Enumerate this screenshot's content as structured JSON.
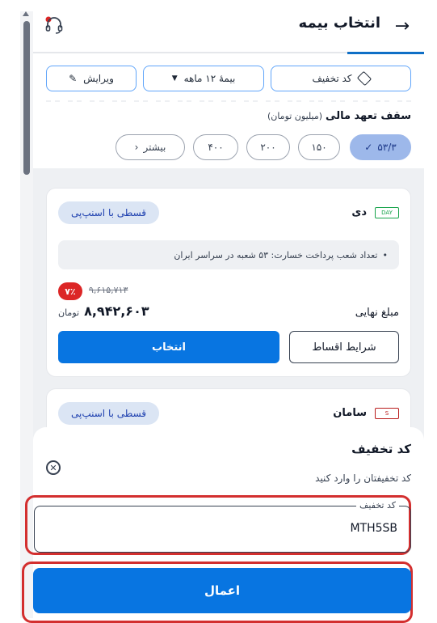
{
  "header": {
    "title": "انتخاب بیمه",
    "back_icon": "arrow-right-icon",
    "support_icon": "headset-icon"
  },
  "filters": {
    "discount_label": "کد تخفیف",
    "insurance_period_label": "بیمهٔ ۱۲ ماهه",
    "edit_label": "ویرایش"
  },
  "coverage": {
    "label": "سقف تعهد مالی",
    "unit": "(میلیون تومان)",
    "options": [
      "۵۳/۳",
      "۱۵۰",
      "۲۰۰",
      "۴۰۰",
      "بیشتر"
    ],
    "selected_index": 0
  },
  "cards": [
    {
      "insurer": "دی",
      "badge": "قسطی با اسنپ‌پی",
      "info": "تعداد شعب پرداخت خسارت: ۵۳ شعبه در سراسر ایران",
      "discount_percent": "۷٪",
      "old_price": "۹,۶۱۵,۷۱۳",
      "final_label": "مبلغ نهایی",
      "final_price": "۸,۹۴۲,۶۰۳",
      "currency": "تومان",
      "select_label": "انتخاب",
      "terms_label": "شرایط اقساط"
    },
    {
      "insurer": "سامان",
      "badge": "قسطی با اسنپ‌پی"
    }
  ],
  "sheet": {
    "title": "کد تخفیف",
    "subtitle": "کد تخفیفتان را وارد کنید",
    "field_label": "کد تخفیف",
    "field_value": "MTH5SB",
    "apply_label": "اعمال"
  },
  "colors": {
    "primary": "#0875e1",
    "discount_red": "#dc2626",
    "highlight_red": "#d32f2f",
    "selected_chip": "#9db8ea"
  }
}
